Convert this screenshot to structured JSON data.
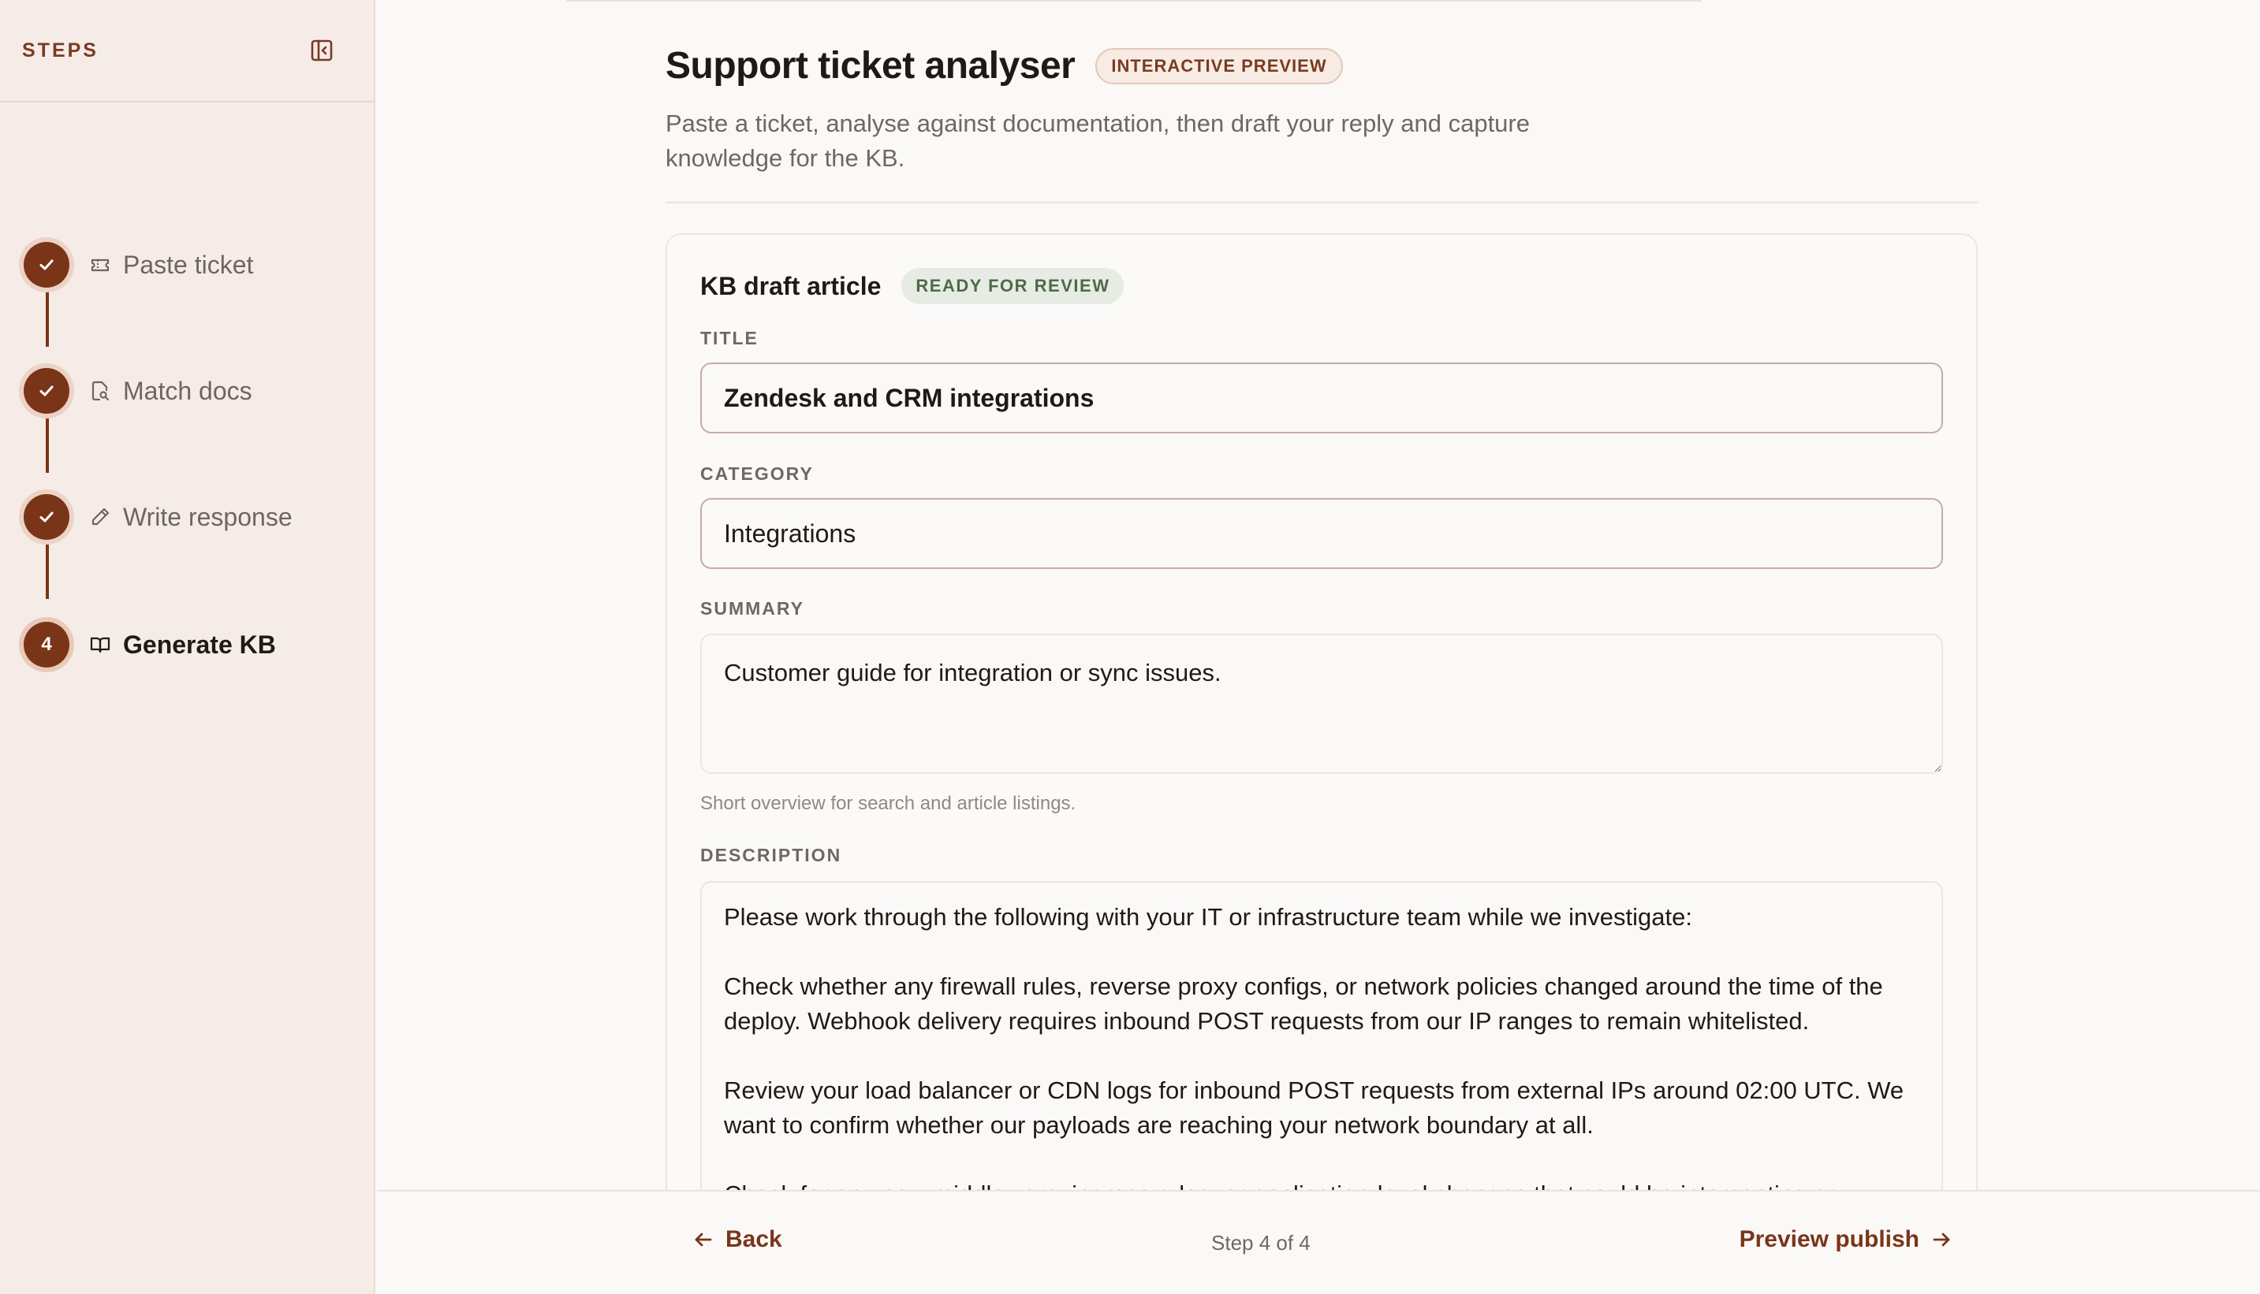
{
  "sidebar": {
    "title": "STEPS",
    "collapse_icon": "sidebar-collapse-icon",
    "steps": [
      {
        "label": "Paste ticket",
        "icon": "ticket-icon",
        "status": "complete"
      },
      {
        "label": "Match docs",
        "icon": "doc-search-icon",
        "status": "complete"
      },
      {
        "label": "Write response",
        "icon": "pencil-icon",
        "status": "complete"
      },
      {
        "label": "Generate KB",
        "icon": "book-icon",
        "status": "current",
        "number": "4"
      }
    ]
  },
  "header": {
    "title": "Support ticket analyser",
    "badge": "INTERACTIVE PREVIEW",
    "subtitle": "Paste a ticket, analyse against documentation, then draft your reply and capture knowledge for the KB."
  },
  "card": {
    "title": "KB draft article",
    "status_badge": "READY FOR REVIEW",
    "fields": {
      "title_label": "TITLE",
      "title_value": "Zendesk and CRM integrations",
      "category_label": "CATEGORY",
      "category_value": "Integrations",
      "summary_label": "SUMMARY",
      "summary_value": "Customer guide for integration or sync issues.",
      "summary_hint": "Short overview for search and article listings.",
      "description_label": "DESCRIPTION",
      "description_paragraphs": [
        "Please work through the following with your IT or infrastructure team while we investigate:",
        "Check whether any firewall rules, reverse proxy configs, or network policies changed around the time of the deploy. Webhook delivery requires inbound POST requests from our IP ranges to remain whitelisted.",
        "Review your load balancer or CDN logs for inbound POST requests from external IPs around 02:00 UTC. We want to confirm whether our payloads are reaching your network boundary at all.",
        "Check for any new middleware, ingress rules, or application-level changes that could be intercepting or"
      ]
    }
  },
  "footer": {
    "back_label": "Back",
    "step_counter": "Step 4 of 4",
    "next_label": "Preview publish"
  },
  "colors": {
    "accent": "#7a3518",
    "sidebar_bg": "#f5ece7",
    "ready_badge_bg": "#e6ece3",
    "ready_badge_text": "#4e6a48"
  }
}
